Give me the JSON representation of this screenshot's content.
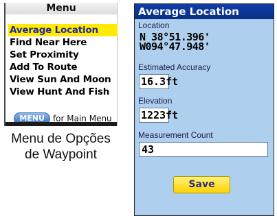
{
  "menu": {
    "title": "Menu",
    "items": [
      {
        "label": "Average Location",
        "selected": true
      },
      {
        "label": "Find Near Here"
      },
      {
        "label": "Set Proximity"
      },
      {
        "label": "Add To Route"
      },
      {
        "label": "View Sun And Moon"
      },
      {
        "label": "View Hunt And Fish"
      }
    ],
    "key_label": "MENU",
    "hint_text": "for Main Menu"
  },
  "caption": {
    "line1": "Menu de Opções",
    "line2": "de Waypoint"
  },
  "average_location": {
    "title": "Average Location",
    "location_label": "Location",
    "latitude": "N  38°51.396'",
    "longitude": "W094°47.948'",
    "accuracy_label": "Estimated Accuracy",
    "accuracy_value": "16.3ft",
    "elevation_label": "Elevation",
    "elevation_value": "1223ft",
    "count_label": "Measurement Count",
    "count_value": "43",
    "save_label": "Save"
  },
  "colors": {
    "title_bar": "#0f3ea8",
    "section_bg": "#aed0ee",
    "highlight": "#ffea00",
    "highlight_text": "#1e2aa8",
    "button": "#ffd200"
  }
}
